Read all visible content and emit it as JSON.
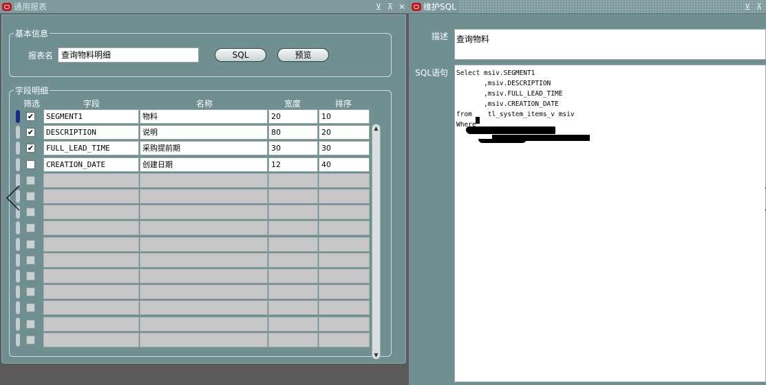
{
  "left_window": {
    "title": "通用报表",
    "basic_info": {
      "legend": "基本信息",
      "report_name_label": "报表名",
      "report_name_value": "查询物料明细",
      "sql_button": "SQL",
      "preview_button": "预览"
    },
    "fields": {
      "legend": "字段明细",
      "columns": {
        "filter": "筛选",
        "field": "字段",
        "name": "名称",
        "width": "宽度",
        "sort": "排序"
      },
      "rows": [
        {
          "checked": true,
          "field": "SEGMENT1",
          "name": "物料",
          "width": "20",
          "sort": "10"
        },
        {
          "checked": true,
          "field": "DESCRIPTION",
          "name": "说明",
          "width": "80",
          "sort": "20"
        },
        {
          "checked": true,
          "field": "FULL_LEAD_TIME",
          "name": "采购提前期",
          "width": "30",
          "sort": "30"
        },
        {
          "checked": false,
          "field": "CREATION_DATE",
          "name": "创建日期",
          "width": "12",
          "sort": "40"
        }
      ],
      "check_mark": "✔"
    }
  },
  "right_window": {
    "title": "维护SQL",
    "desc_label": "描述",
    "desc_value": "查询物料",
    "sql_label": "SQL语句",
    "sql_text": "Select msiv.SEGMENT1\n       ,msiv.DESCRIPTION\n       ,msiv.FULL_LEAD_TIME\n       ,msiv.CREATION_DATE\nfrom    tl_system_items_v msiv\nWhere"
  },
  "icons": {
    "minimize": "minimize-icon",
    "maximize": "maximize-icon",
    "close": "close-icon"
  }
}
